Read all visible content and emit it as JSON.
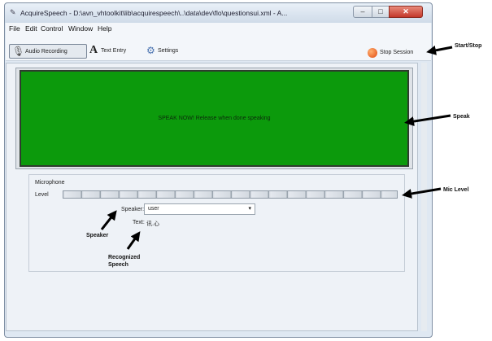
{
  "window": {
    "title": "AcquireSpeech - D:\\avn_vhtoolkit\\lib\\acquirespeech\\..\\data\\dev\\flo\\questionsui.xml - A...",
    "minimize": "–",
    "maximize": "□",
    "close": "✕"
  },
  "menu": [
    "File",
    "Edit",
    "Control",
    "Window",
    "Help"
  ],
  "toolbar": {
    "audio_recording": "Audio Recording",
    "text_entry": "Text Entry",
    "settings": "Settings",
    "stop_session": "Stop Session"
  },
  "speak_panel": {
    "message": "SPEAK NOW! Release when done speaking",
    "color": "#0c9a0c"
  },
  "microphone": {
    "group_label": "Microphone",
    "level_label": "Level",
    "level": 0
  },
  "speaker": {
    "label": "Speaker:",
    "value": "user"
  },
  "text": {
    "label": "Text:",
    "value": "讯.心"
  },
  "annotations": {
    "start_stop": "Start/Stop",
    "speak": "Speak",
    "mic_level": "Mic Level",
    "speaker": "Speaker",
    "recognized_line1": "Recognized",
    "recognized_line2": "Speech"
  }
}
